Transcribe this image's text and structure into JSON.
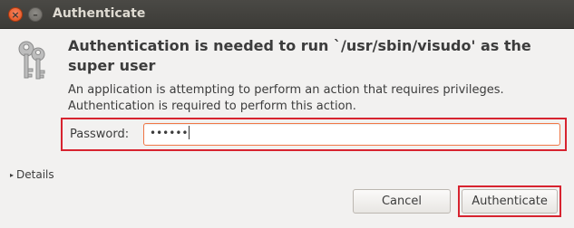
{
  "window": {
    "title": "Authenticate",
    "close_glyph": "×",
    "minimize_glyph": "–"
  },
  "dialog": {
    "headline": "Authentication is needed to run `/usr/sbin/visudo' as the super user",
    "description": "An application is attempting to perform an action that requires privileges. Authentication is required to perform this action.",
    "password_label": "Password:",
    "password_value": "••••••",
    "details_label": "Details",
    "details_arrow": "▸",
    "cancel_label": "Cancel",
    "authenticate_label": "Authenticate",
    "icon": "keys-icon"
  },
  "colors": {
    "highlight": "#d7232f",
    "focus": "#f07746",
    "titlebar": "#3c3b37"
  }
}
